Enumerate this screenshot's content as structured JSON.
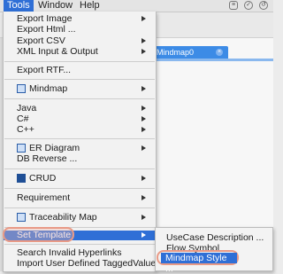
{
  "menubar": {
    "items": [
      "Tools",
      "Window",
      "Help"
    ]
  },
  "background": {
    "tab_label": "Mindmap0",
    "tab_close": "×"
  },
  "menu": {
    "items": [
      {
        "label": "Export Image",
        "arrow": true
      },
      {
        "label": "Export Html ..."
      },
      {
        "label": "Export CSV",
        "arrow": true
      },
      {
        "label": "XML Input & Output",
        "arrow": true
      },
      {
        "label": "Export RTF..."
      },
      {
        "label": "Mindmap",
        "arrow": true,
        "icon": "mindmap-icon"
      },
      {
        "label": "Java",
        "arrow": true
      },
      {
        "label": "C#",
        "arrow": true
      },
      {
        "label": "C++",
        "arrow": true
      },
      {
        "label": "ER Diagram",
        "arrow": true,
        "icon": "er-diagram-icon"
      },
      {
        "label": "DB Reverse ..."
      },
      {
        "label": "CRUD",
        "arrow": true,
        "icon": "crud-icon"
      },
      {
        "label": "Requirement",
        "arrow": true
      },
      {
        "label": "Traceability Map",
        "arrow": true,
        "icon": "traceability-icon"
      },
      {
        "label": "Set Template",
        "arrow": true,
        "selected": true
      },
      {
        "label": "Search Invalid Hyperlinks"
      },
      {
        "label": "Import User Defined TaggedValue"
      }
    ]
  },
  "submenu": {
    "items": [
      "UseCase Description ...",
      "Flow Symbol",
      "Mindmap Style ..."
    ],
    "selected_index": 2
  },
  "colors": {
    "selection": "#2f6fd6",
    "highlight_ring": "#e99a86",
    "tab": "#3c8be6"
  }
}
